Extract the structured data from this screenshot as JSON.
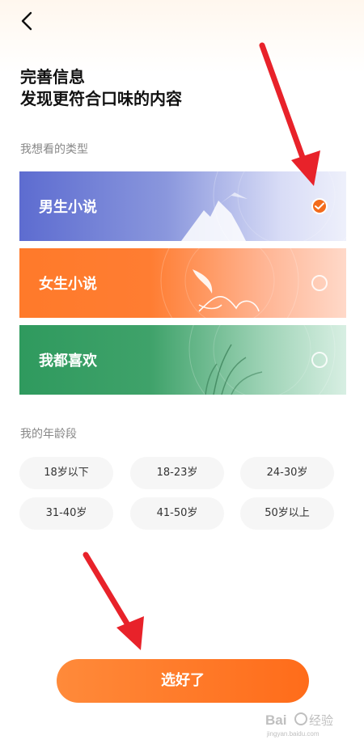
{
  "header": {
    "back_icon": "chevron-left-icon",
    "title_line1": "完善信息",
    "title_line2": "发现更符合口味的内容"
  },
  "genre_section": {
    "label": "我想看的类型",
    "options": [
      {
        "label": "男生小说",
        "checked": true,
        "color": "#5d6cd0"
      },
      {
        "label": "女生小说",
        "checked": false,
        "color": "#ff7a2a"
      },
      {
        "label": "我都喜欢",
        "checked": false,
        "color": "#2f9a5e"
      }
    ]
  },
  "age_section": {
    "label": "我的年龄段",
    "options": [
      "18岁以下",
      "18-23岁",
      "24-30岁",
      "31-40岁",
      "41-50岁",
      "50岁以上"
    ]
  },
  "confirm_button": {
    "label": "选好了"
  },
  "accent_color": "#f36b1c",
  "annotation_arrow_color": "#e8222a",
  "watermark": {
    "text": "Baidu经验",
    "subtext": "jingyan.baidu.com"
  }
}
